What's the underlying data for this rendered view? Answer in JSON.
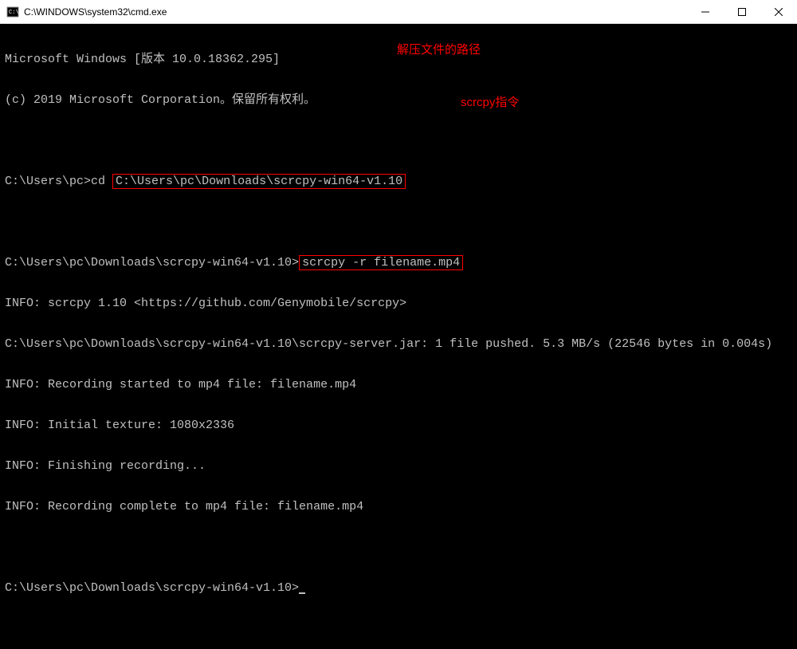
{
  "window": {
    "title": "C:\\WINDOWS\\system32\\cmd.exe"
  },
  "annotations": {
    "unzip_path": "解压文件的路径",
    "scrcpy_cmd": "scrcpy指令"
  },
  "lines": {
    "l1": "Microsoft Windows [版本 10.0.18362.295]",
    "l2": "(c) 2019 Microsoft Corporation。保留所有权利。",
    "l3_prompt": "C:\\Users\\pc>",
    "l3_cmd_prefix": "cd ",
    "l3_boxed": "C:\\Users\\pc\\Downloads\\scrcpy-win64-v1.10",
    "l4_prompt": "C:\\Users\\pc\\Downloads\\scrcpy-win64-v1.10>",
    "l4_boxed": "scrcpy -r filename.mp4",
    "l5": "INFO: scrcpy 1.10 <https://github.com/Genymobile/scrcpy>",
    "l6": "C:\\Users\\pc\\Downloads\\scrcpy-win64-v1.10\\scrcpy-server.jar: 1 file pushed. 5.3 MB/s (22546 bytes in 0.004s)",
    "l7": "INFO: Recording started to mp4 file: filename.mp4",
    "l8": "INFO: Initial texture: 1080x2336",
    "l9": "INFO: Finishing recording...",
    "l10": "INFO: Recording complete to mp4 file: filename.mp4",
    "l11_prompt": "C:\\Users\\pc\\Downloads\\scrcpy-win64-v1.10>"
  }
}
